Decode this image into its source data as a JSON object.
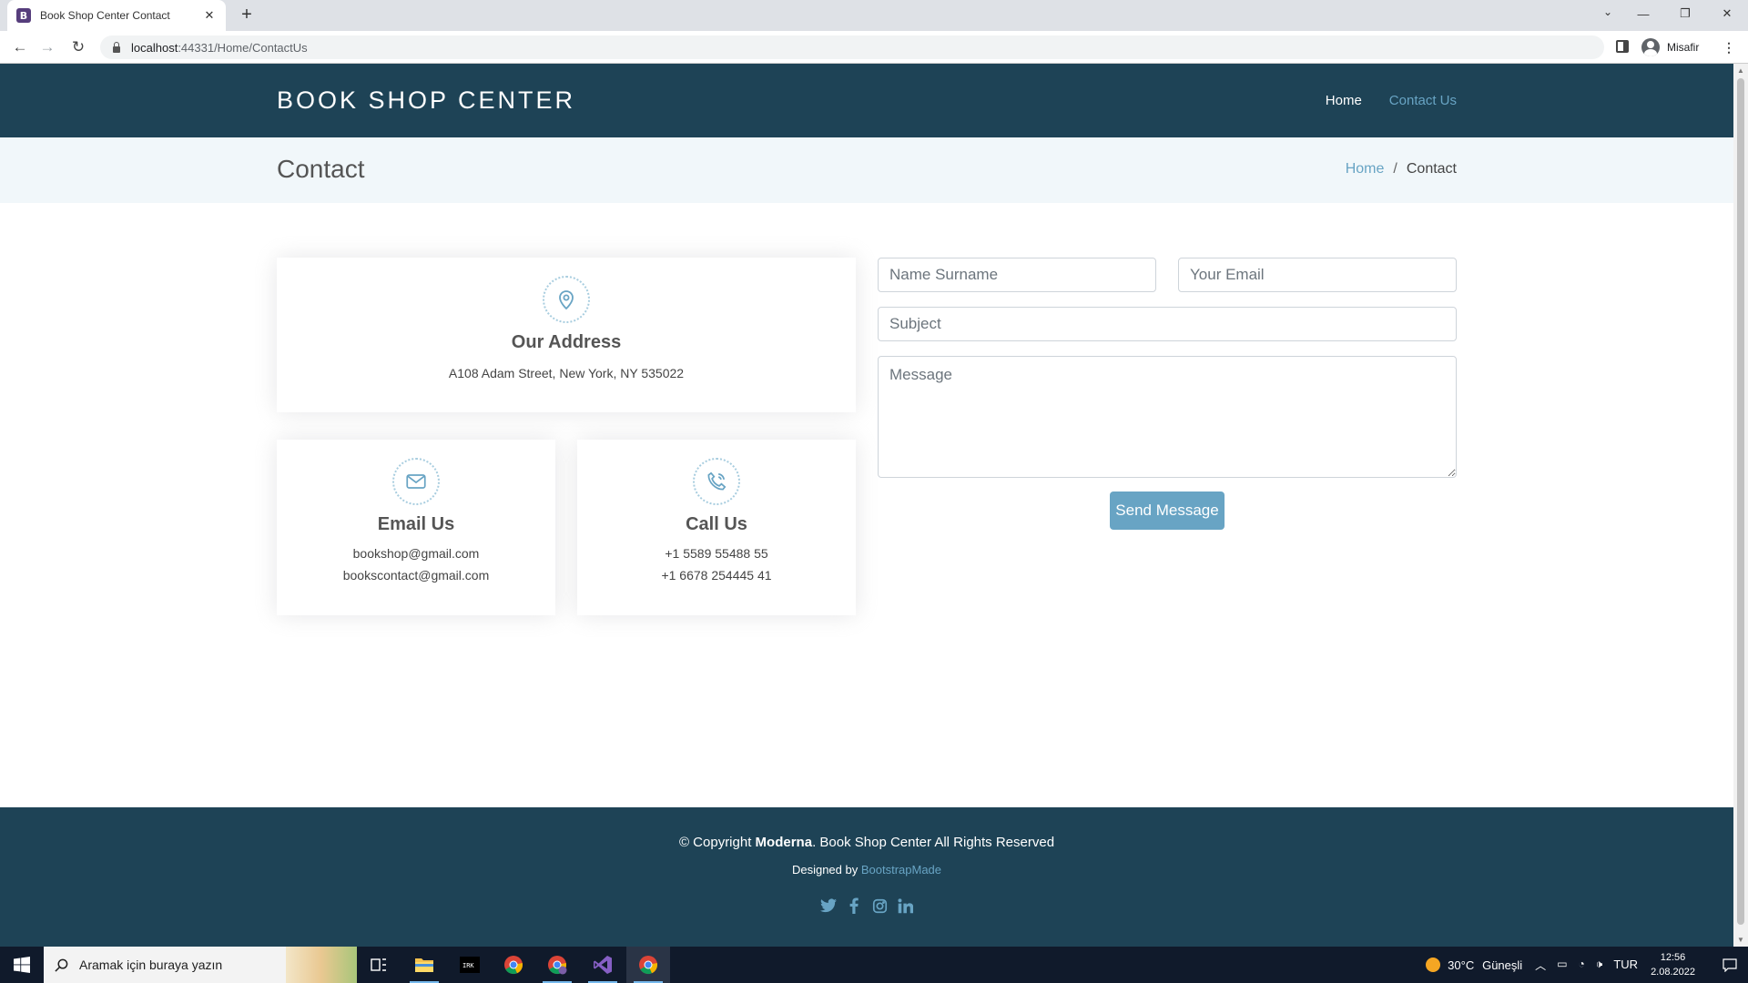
{
  "browser": {
    "tab_title": "Book Shop Center Contact",
    "favicon_letter": "B",
    "url_host": "localhost",
    "url_path": ":44331/Home/ContactUs",
    "profile_name": "Misafir",
    "close_glyph": "✕",
    "new_tab_glyph": "+",
    "min_glyph": "—",
    "restore_glyph": "❐",
    "win_close_glyph": "✕",
    "tab_search_glyph": "⌄",
    "back_glyph": "←",
    "forward_glyph": "→",
    "reload_glyph": "↻",
    "menu_glyph": "⋮"
  },
  "site": {
    "logo": "BOOK SHOP CENTER",
    "nav": {
      "home": "Home",
      "contact": "Contact Us"
    },
    "page_title": "Contact",
    "breadcrumb": {
      "home": "Home",
      "separator": "/",
      "current": "Contact"
    }
  },
  "contact": {
    "address": {
      "title": "Our Address",
      "line": "A108 Adam Street, New York, NY 535022"
    },
    "email": {
      "title": "Email Us",
      "lines": [
        "bookshop@gmail.com",
        "bookscontact@gmail.com"
      ]
    },
    "call": {
      "title": "Call Us",
      "lines": [
        "+1 5589 55488 55",
        "+1 6678 254445 41"
      ]
    }
  },
  "form": {
    "name_placeholder": "Name Surname",
    "email_placeholder": "Your Email",
    "subject_placeholder": "Subject",
    "message_placeholder": "Message",
    "send_label": "Send Message"
  },
  "footer": {
    "copyright_prefix": "© Copyright ",
    "copyright_brand": "Moderna",
    "copyright_suffix": ". Book Shop Center All Rights Reserved",
    "designed_prefix": "Designed by ",
    "designed_link": "BootstrapMade",
    "social": [
      "twitter-icon",
      "facebook-icon",
      "instagram-icon",
      "linkedin-icon"
    ]
  },
  "taskbar": {
    "search_placeholder": "Aramak için buraya yazın",
    "weather": "30°C",
    "weather_desc": "Güneşli",
    "language": "TUR",
    "time": "12:56",
    "date": "2.08.2022",
    "apps": [
      "task-view-icon",
      "file-explorer-icon",
      "terminal-icon",
      "chrome-icon",
      "chrome-profile-icon",
      "visual-studio-icon",
      "chrome-active-icon"
    ]
  },
  "colors": {
    "header_bg": "#1e4356",
    "accent": "#68a4c4",
    "breadcrumb_bg": "#f1f7fa"
  }
}
